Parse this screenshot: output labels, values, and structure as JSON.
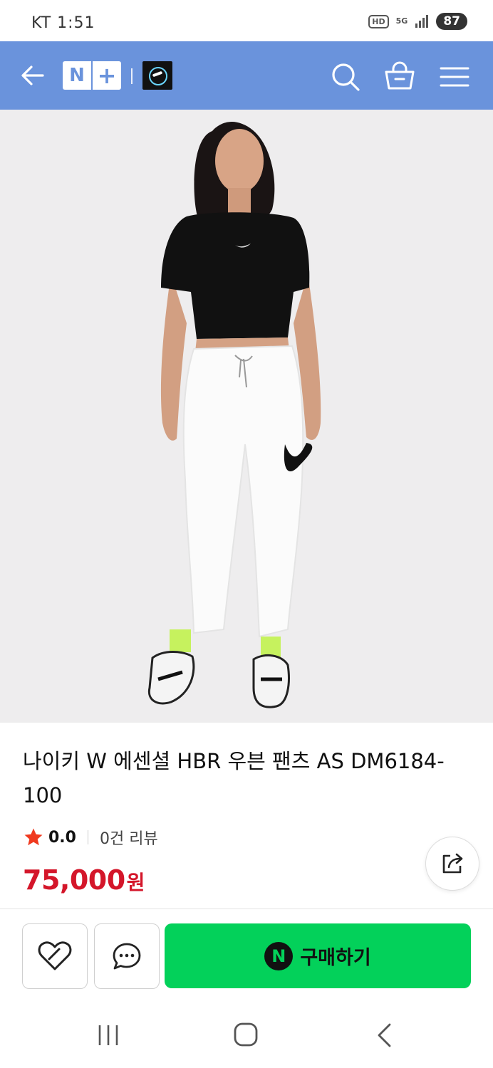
{
  "status_bar": {
    "carrier_time": "KT 1:51",
    "hd_label": "HD",
    "network_label": "5G",
    "battery": "87"
  },
  "header": {
    "logo_n": "N",
    "logo_plus": "+",
    "background_color": "#6a93dc",
    "icons": [
      "arrow-left-icon",
      "search-icon",
      "shopping-basket-icon",
      "hamburger-menu-icon"
    ]
  },
  "product": {
    "title": "나이키 W 에센셜 HBR 우븐 팬츠 AS DM6184-100",
    "rating": "0.0",
    "review_count": "0건 리뷰",
    "price": "75,000",
    "currency": "원",
    "price_color": "#d4162a"
  },
  "actions": {
    "buy_label": "구매하기",
    "npay_letter": "N",
    "buy_color": "#03d15a",
    "icons": [
      "heart-icon",
      "chat-bubble-icon",
      "share-icon"
    ]
  },
  "system_nav": {
    "icons": [
      "recent-apps-icon",
      "home-icon",
      "back-icon"
    ]
  }
}
